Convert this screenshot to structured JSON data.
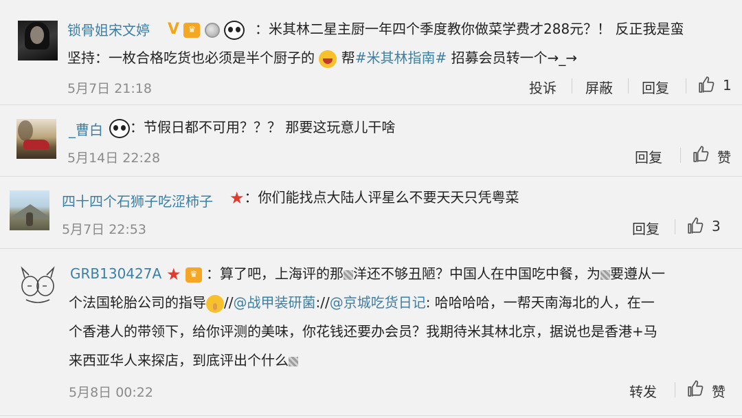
{
  "comments": [
    {
      "name": "锁骨姐宋文婷",
      "sep": "：",
      "text_line1": "米其林二星主厨一年四个季度教你做菜学费才288元？！ 反正我是蛮",
      "text_line2_a": "坚持：一枚合格吃货也必须是半个厨子的",
      "text_line2_b": " 帮",
      "hashtag": "#米其林指南#",
      "text_line2_c": " 招募会员转一个→_→",
      "date": "5月7日 21:18",
      "actions": [
        "投诉",
        "屏蔽",
        "回复"
      ],
      "like_count": "1"
    },
    {
      "name": "_曹白",
      "sep": "：",
      "text": "节假日都不可用？？？ 那要这玩意儿干啥",
      "date": "5月14日 22:28",
      "actions": [
        "回复"
      ],
      "like_count": "赞"
    },
    {
      "name": "四十四个石狮子吃涩柿子",
      "sep": "：",
      "text": "你们能找点大陆人评星么不要天天只凭粤菜",
      "date": "5月7日 22:53",
      "actions": [
        "回复"
      ],
      "like_count": "3"
    },
    {
      "name": "GRB130427A",
      "sep": "：",
      "line1_a": "算了吧，上海评的那",
      "line1_b": "洋还不够丑陋？中国人在中国吃中餐，为",
      "line1_c": "要遵从一",
      "line2_a": "个法国轮胎公司的指导",
      "line2_b": "//",
      "mention1": "@战甲装研菌",
      "line2_c": "://",
      "mention2": "@京城吃货日记",
      "line2_d": ": 哈哈哈哈，一帮天南海北的人，在一",
      "line3": "个香港人的带领下，给你评测的美味，你花钱还要办会员？我期待米其林北京，据说也是香港+马",
      "line4": "来西亚华人来探店，到底评出个什么",
      "date": "5月8日 00:22",
      "actions": [
        "转发"
      ],
      "like_count": "赞"
    }
  ],
  "colors": {
    "name": "#3b7fa5",
    "background": "#f2f2f2",
    "divider": "#dcdcdc",
    "date": "#8a8a8a"
  },
  "icons": {
    "like": "thumbs-up-icon",
    "vip_v": "verified-v-icon",
    "crown": "vip-crown-icon",
    "medal": "medal-icon",
    "panda": "panda-icon",
    "star": "red-star-icon"
  }
}
